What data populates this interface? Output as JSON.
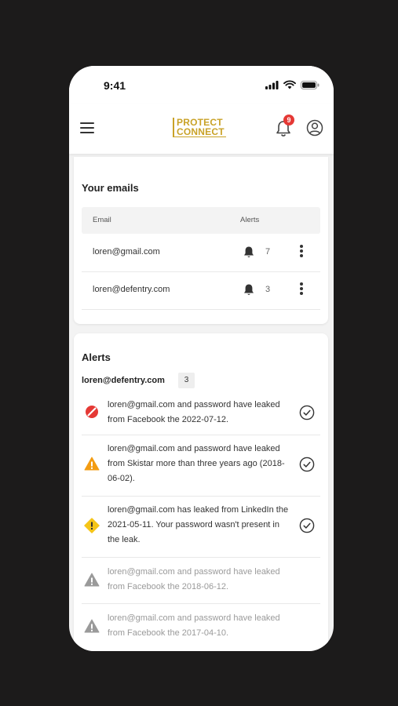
{
  "status_bar": {
    "time": "9:41"
  },
  "app_bar": {
    "logo_line1": "PROTECT",
    "logo_line2": "CONNECT",
    "notification_count": "9"
  },
  "emails_section": {
    "title": "Your emails",
    "columns": {
      "email": "Email",
      "alerts": "Alerts"
    },
    "rows": [
      {
        "email": "loren@gmail.com",
        "alerts": "7"
      },
      {
        "email": "loren@defentry.com",
        "alerts": "3"
      }
    ]
  },
  "alerts_section": {
    "title": "Alerts",
    "filter_email": "loren@defentry.com",
    "filter_count": "3",
    "items": [
      {
        "icon": "blocked-icon",
        "text": "loren@gmail.com and password have leaked from Facebook the 2022-07-12."
      },
      {
        "icon": "warning-triangle-icon",
        "text": "loren@gmail.com and password have leaked from Skistar more than three years ago (2018-06-02)."
      },
      {
        "icon": "warning-diamond-icon",
        "text": "loren@gmail.com has leaked from LinkedIn the 2021-05-11. Your password wasn't present in the leak."
      },
      {
        "icon": "warning-triangle-gray-icon",
        "text": "loren@gmail.com and password have leaked from Facebook the 2018-06-12."
      },
      {
        "icon": "warning-triangle-gray-icon",
        "text": "loren@gmail.com and password have leaked from Facebook the 2017-04-10."
      }
    ]
  },
  "colors": {
    "brand_gold": "#c9a227",
    "badge_red": "#e53935",
    "danger": "#e53935",
    "warning": "#f39c12",
    "caution": "#f5c518",
    "muted": "#9a9a9a"
  }
}
